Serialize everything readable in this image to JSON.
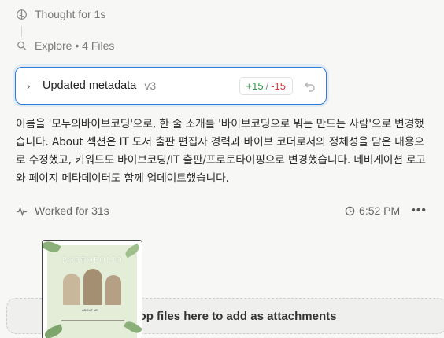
{
  "steps": {
    "thought": "Thought for 1s",
    "explore": "Explore • 4 Files"
  },
  "card": {
    "title": "Updated metadata",
    "version": "v3",
    "additions": "+15",
    "separator": "/",
    "deletions": "-15"
  },
  "message": "이름을 '모두의바이브코딩'으로, 한 줄 소개를 '바이브코딩으로 뭐든 만드는 사람'으로 변경했습니다. About 섹션은 IT 도서 출판 편집자 경력과 바이브 코더로서의 정체성을 담은 내용으로 수정했고, 키워드도 바이브코딩/IT 출판/프로토타이핑으로 변경했습니다. 네비게이션 로고와 페이지 메타데이터도 함께 업데이트했습니다.",
  "footer": {
    "worked": "Worked for 31s",
    "time": "6:52 PM",
    "more": "•••"
  },
  "dropzone": "op files here to add as attachments",
  "attachment": {
    "poster_title": "PORTOFOLIO",
    "poster_sub": "ABOUT ME"
  },
  "colors": {
    "accent": "#2f7bd8",
    "additions": "#2e9a45",
    "deletions": "#d6333a"
  }
}
